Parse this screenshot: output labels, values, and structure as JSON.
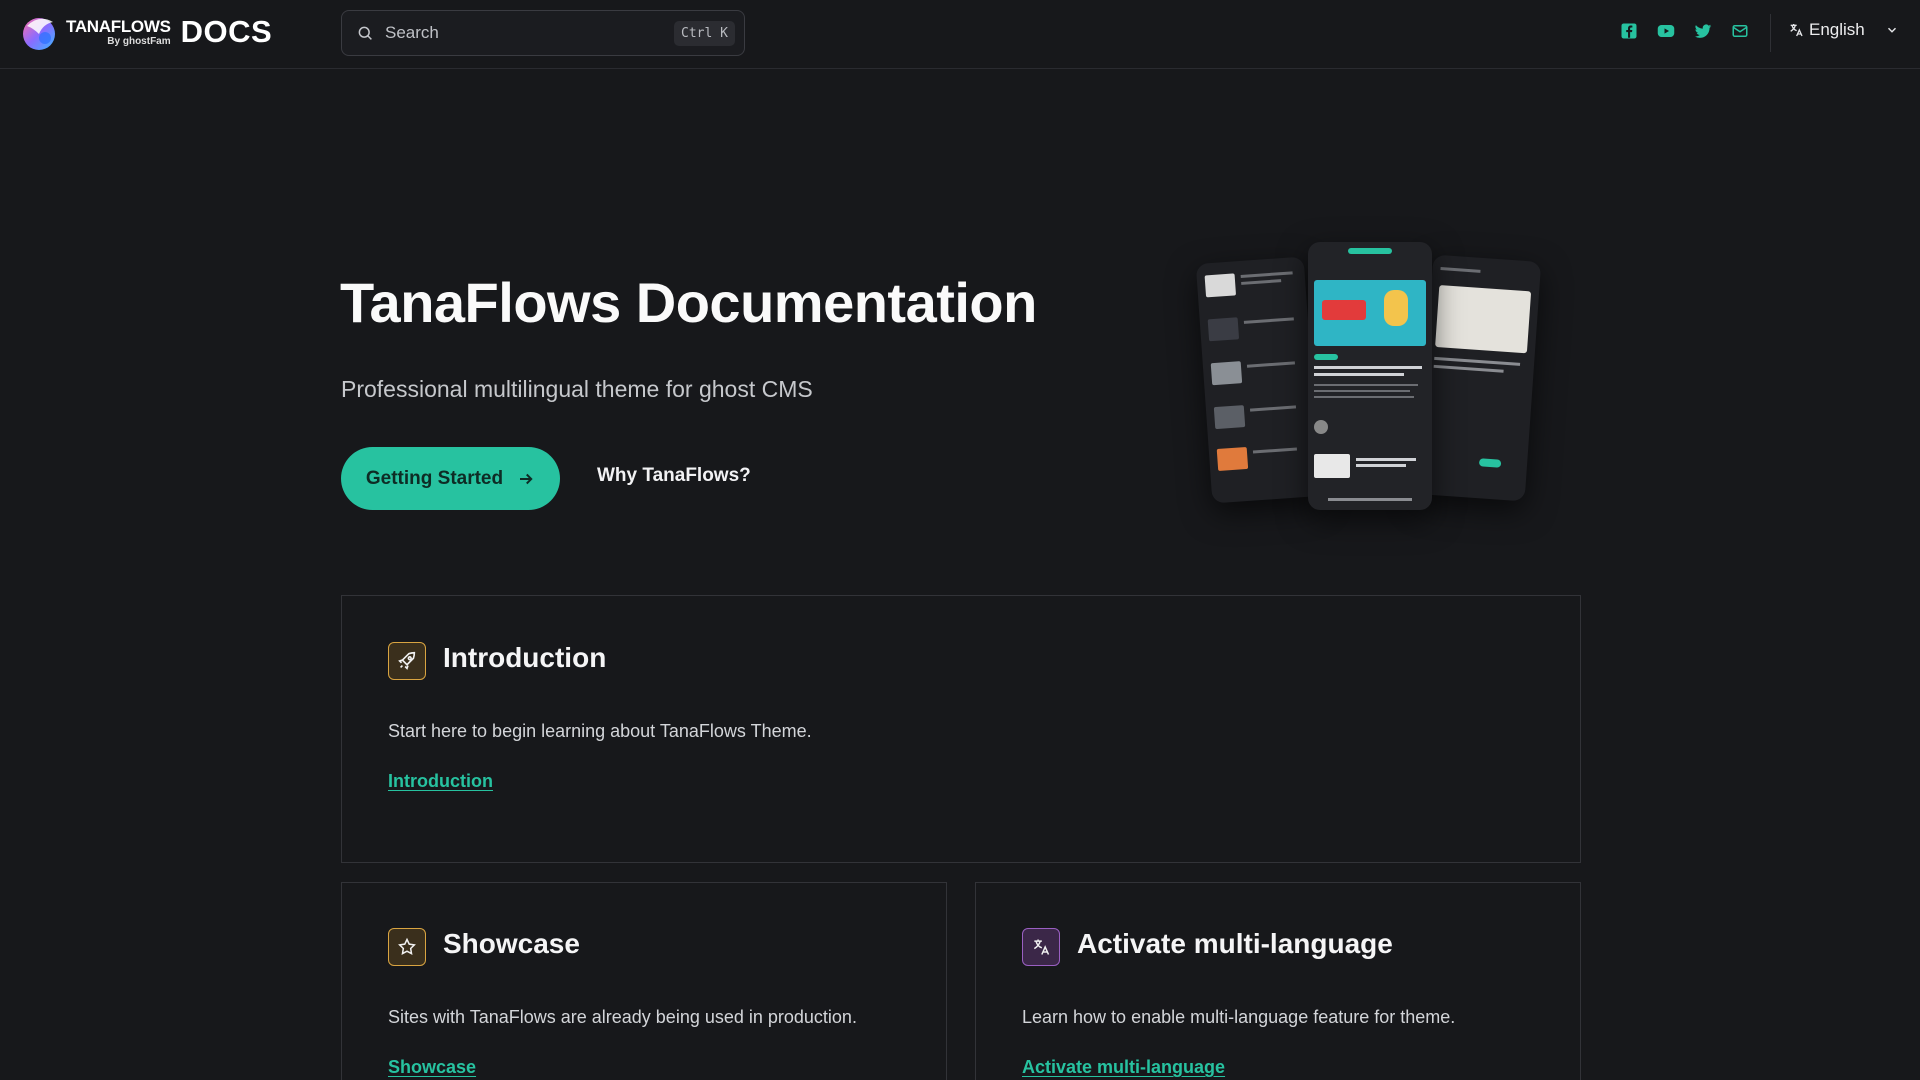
{
  "header": {
    "brand_name": "TANAFLOWS",
    "brand_by": "By ghostFam",
    "brand_docs": "DOCS",
    "search_placeholder": "Search",
    "search_shortcut": "Ctrl K",
    "social_icons": [
      "facebook-icon",
      "youtube-icon",
      "twitter-icon",
      "mail-icon"
    ],
    "language": "English",
    "accent_color": "#27c2a0"
  },
  "hero": {
    "title": "TanaFlows Documentation",
    "subtitle": "Professional multilingual theme for ghost CMS",
    "primary_button": "Getting Started",
    "secondary_button": "Why TanaFlows?"
  },
  "cards": [
    {
      "icon": "rocket-icon",
      "title": "Introduction",
      "description": "Start here to begin learning about TanaFlows Theme.",
      "link": "Introduction"
    },
    {
      "icon": "star-icon",
      "title": "Showcase",
      "description": "Sites with TanaFlows are already being used in production.",
      "link": "Showcase"
    },
    {
      "icon": "translate-icon",
      "title": "Activate multi-language",
      "description": "Learn how to enable multi-language feature for theme.",
      "link": "Activate multi-language"
    }
  ]
}
